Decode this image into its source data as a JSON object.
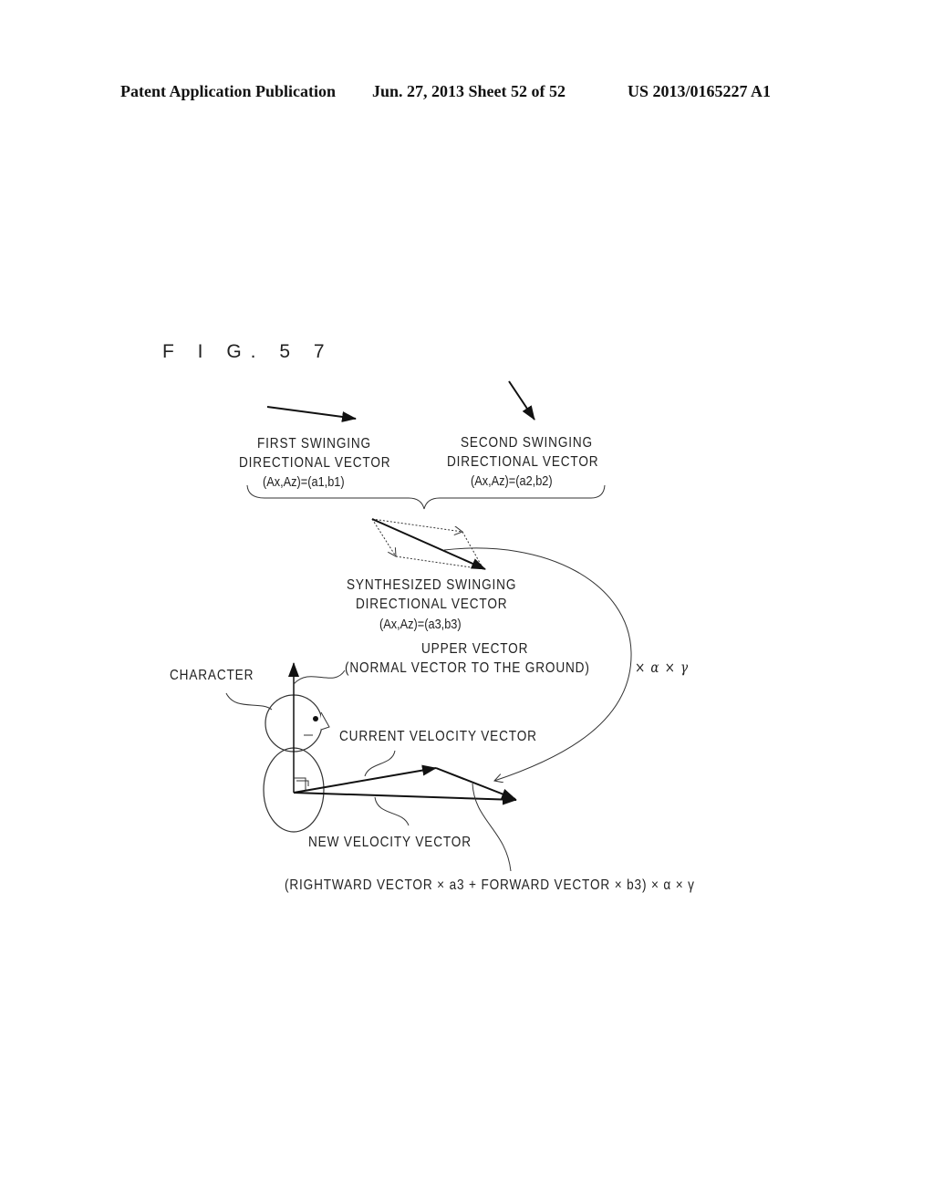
{
  "header": {
    "publication": "Patent Application Publication",
    "date_sheet": "Jun. 27, 2013  Sheet 52 of 52",
    "patent_number": "US 2013/0165227 A1"
  },
  "figure": {
    "label": "F I G. 5 7",
    "first_vector": {
      "line1": "FIRST SWINGING",
      "line2": "DIRECTIONAL VECTOR",
      "formula": "(Ax,Az)=(a1,b1)"
    },
    "second_vector": {
      "line1": "SECOND SWINGING",
      "line2": "DIRECTIONAL VECTOR",
      "formula": "(Ax,Az)=(a2,b2)"
    },
    "synthesized_vector": {
      "line1": "SYNTHESIZED SWINGING",
      "line2": "DIRECTIONAL VECTOR",
      "formula": "(Ax,Az)=(a3,b3)"
    },
    "upper_vector": {
      "line1": "UPPER VECTOR",
      "line2": "(NORMAL VECTOR TO THE GROUND)"
    },
    "character_label": "CHARACTER",
    "multiplier": "× α × γ",
    "current_velocity": "CURRENT VELOCITY VECTOR",
    "new_velocity": "NEW VELOCITY VECTOR",
    "equation": "(RIGHTWARD VECTOR × a3 + FORWARD VECTOR × b3)  × α × γ"
  }
}
